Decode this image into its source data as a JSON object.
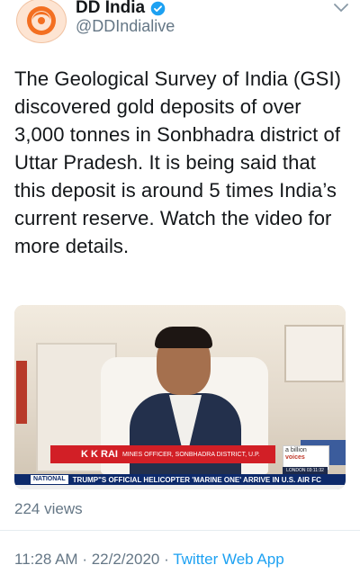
{
  "account": {
    "display_name": "DD India",
    "handle": "@DDIndialive",
    "avatar_icon": "dd-logo-icon",
    "verified": true
  },
  "tweet": {
    "text": "The Geological Survey of India (GSI) discovered gold deposits of over 3,000 tonnes in Sonbhadra district of Uttar Pradesh. It is being said that this deposit is around 5 times India’s current reserve. Watch the video for more details."
  },
  "video": {
    "lower_third_name": "K K RAI",
    "lower_third_role": "MINES OFFICER, SONBHADRA DISTRICT, U.P.",
    "brand_line1": "a billion",
    "brand_line2": "voices",
    "london_time": "LONDON 03:11:32",
    "ticker_tag": "NATIONAL",
    "ticker_text": "TRUMP\"S OFFICIAL HELICOPTER 'MARINE ONE' ARRIVE IN U.S. AIR FC"
  },
  "stats": {
    "views": "224 views"
  },
  "meta": {
    "time": "11:28 AM",
    "separator": "·",
    "date": "22/2/2020",
    "source": "Twitter Web App"
  },
  "colors": {
    "accent": "#1da1f2",
    "brand_orange": "#f36f21",
    "secondary_text": "#657786"
  }
}
